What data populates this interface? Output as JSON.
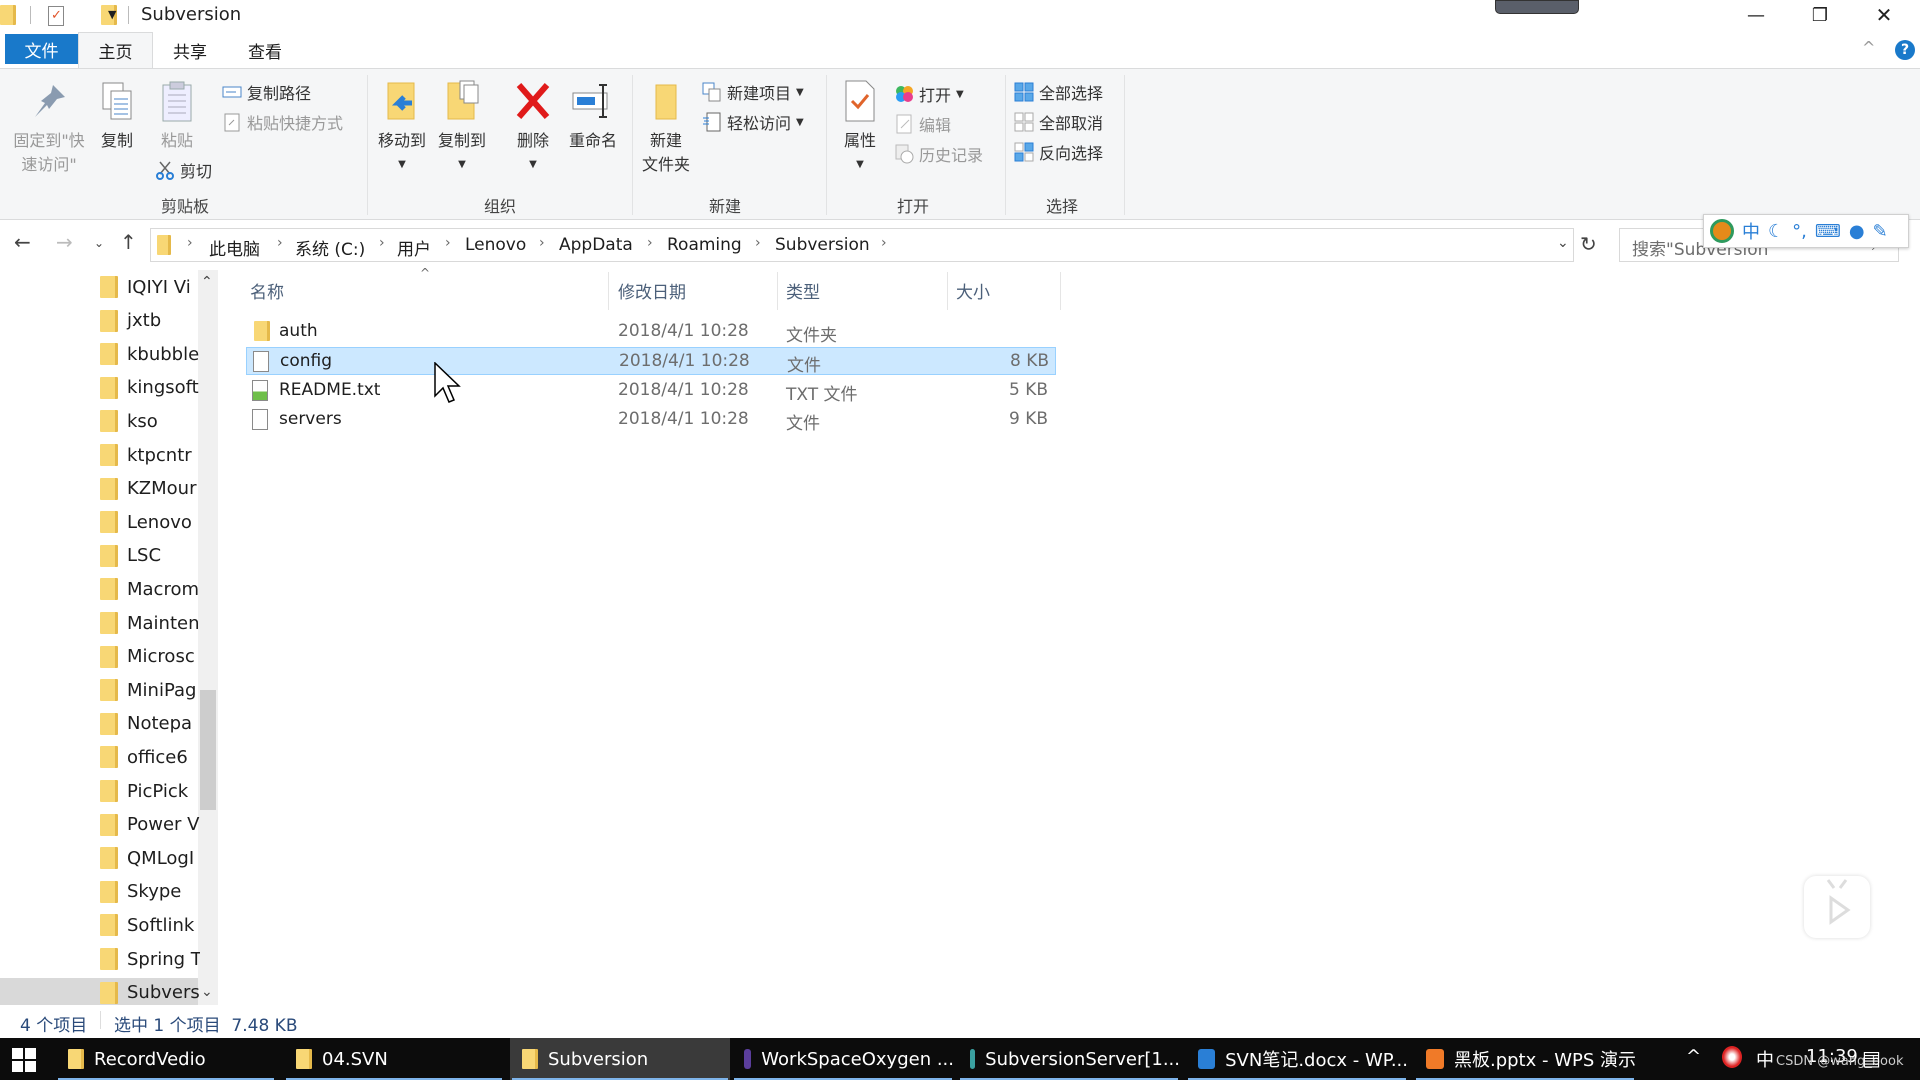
{
  "window": {
    "title": "Subversion",
    "controls": {
      "minimize": "—",
      "restore": "❐",
      "close": "✕"
    }
  },
  "ribbon": {
    "tabs": [
      {
        "label": "文件",
        "active": false,
        "style": "file"
      },
      {
        "label": "主页",
        "active": true
      },
      {
        "label": "共享",
        "active": false
      },
      {
        "label": "查看",
        "active": false
      }
    ],
    "help": "?",
    "collapse": "^",
    "groups": {
      "clipboard": {
        "label": "剪贴板",
        "pin": "固定到\"快\n速访问\"",
        "pin_line1": "固定到\"快",
        "pin_line2": "速访问\"",
        "copy": "复制",
        "paste": "粘贴",
        "copy_path": "复制路径",
        "paste_shortcut": "粘贴快捷方式",
        "cut": "剪切"
      },
      "organize": {
        "label": "组织",
        "move_to": "移动到",
        "copy_to": "复制到",
        "delete": "删除",
        "rename": "重命名"
      },
      "new": {
        "label": "新建",
        "new_folder_line1": "新建",
        "new_folder_line2": "文件夹",
        "new_item": "新建项目",
        "easy_access": "轻松访问"
      },
      "open": {
        "label": "打开",
        "properties": "属性",
        "open": "打开",
        "edit": "编辑",
        "history": "历史记录"
      },
      "select": {
        "label": "选择",
        "select_all": "全部选择",
        "select_none": "全部取消",
        "invert": "反向选择"
      }
    }
  },
  "address": {
    "crumbs": [
      "此电脑",
      "系统 (C:)",
      "用户",
      "Lenovo",
      "AppData",
      "Roaming",
      "Subversion"
    ],
    "search_placeholder": "搜索\"Subversion\"",
    "ime_label": "中"
  },
  "nav_pane": {
    "items": [
      "IQIYI Vi",
      "jxtb",
      "kbubble",
      "kingsoft",
      "kso",
      "ktpcntr",
      "KZMour",
      "Lenovo",
      "LSC",
      "Macrom",
      "Mainten",
      "Microsc",
      "MiniPag",
      "Notepa",
      "office6",
      "PicPick",
      "Power V",
      "QMLogI",
      "Skype",
      "Softlink",
      "Spring T",
      "Subvers"
    ],
    "selected": "Subvers"
  },
  "file_list": {
    "columns": [
      "名称",
      "修改日期",
      "类型",
      "大小"
    ],
    "rows": [
      {
        "name": "auth",
        "date": "2018/4/1 10:28",
        "type": "文件夹",
        "size": "",
        "icon": "folder-icon",
        "selected": false
      },
      {
        "name": "config",
        "date": "2018/4/1 10:28",
        "type": "文件",
        "size": "8 KB",
        "icon": "file-icon",
        "selected": true
      },
      {
        "name": "README.txt",
        "date": "2018/4/1 10:28",
        "type": "TXT 文件",
        "size": "5 KB",
        "icon": "text-file-icon",
        "selected": false
      },
      {
        "name": "servers",
        "date": "2018/4/1 10:28",
        "type": "文件",
        "size": "9 KB",
        "icon": "file-icon",
        "selected": false
      }
    ]
  },
  "status_bar": {
    "item_count": "4 个项目",
    "selection": "选中 1 个项目  7.48 KB"
  },
  "taskbar": {
    "items": [
      {
        "label": "RecordVedio",
        "icon": "folder-icon"
      },
      {
        "label": "04.SVN",
        "icon": "folder-icon"
      },
      {
        "label": "Subversion",
        "icon": "folder-icon",
        "active": true
      },
      {
        "label": "WorkSpaceOxygen ...",
        "icon": "eclipse-icon"
      },
      {
        "label": "SubversionServer[1...",
        "icon": "server-icon"
      },
      {
        "label": "SVN笔记.docx - WP...",
        "icon": "wps-writer-icon"
      },
      {
        "label": "黑板.pptx - WPS 演示",
        "icon": "wps-presentation-icon"
      }
    ],
    "tray": {
      "ime": "中",
      "time": "11:39",
      "watermark": "CSDN @wang_book"
    }
  },
  "colors": {
    "accent": "#1979ca",
    "selection": "#cce8ff",
    "folder": "#f8d775"
  }
}
